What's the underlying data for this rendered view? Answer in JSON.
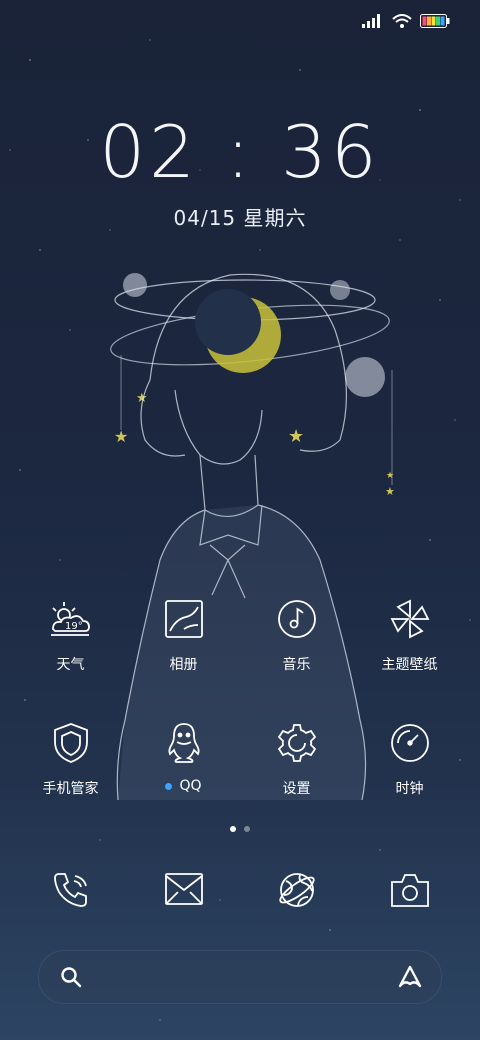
{
  "status_bar": {
    "signal_icon": "signal-bars-icon",
    "wifi_icon": "wifi-icon",
    "battery_icon": "battery-icon"
  },
  "lockscreen": {
    "time": "02 : 36",
    "date": "04/15 星期六"
  },
  "apps_row1": [
    {
      "label": "天气",
      "icon": "weather-icon",
      "temperature": "19°"
    },
    {
      "label": "相册",
      "icon": "gallery-icon"
    },
    {
      "label": "音乐",
      "icon": "music-icon"
    },
    {
      "label": "主题壁纸",
      "icon": "themes-icon"
    }
  ],
  "apps_row2": [
    {
      "label": "手机管家",
      "icon": "security-icon"
    },
    {
      "label": "QQ",
      "icon": "qq-icon",
      "has_update_dot": true
    },
    {
      "label": "设置",
      "icon": "settings-icon"
    },
    {
      "label": "时钟",
      "icon": "clock-icon"
    }
  ],
  "page_indicator": {
    "pages": 2,
    "current": 1
  },
  "dock": [
    {
      "icon": "phone-icon"
    },
    {
      "icon": "messages-icon"
    },
    {
      "icon": "browser-icon"
    },
    {
      "icon": "camera-icon"
    }
  ],
  "search_bar": {
    "search_icon": "search-icon",
    "assistant_icon": "assistant-icon"
  },
  "colors": {
    "accent_dot": "#3ea0ff",
    "moon": "#c9c23a",
    "star": "#cfc65a"
  }
}
